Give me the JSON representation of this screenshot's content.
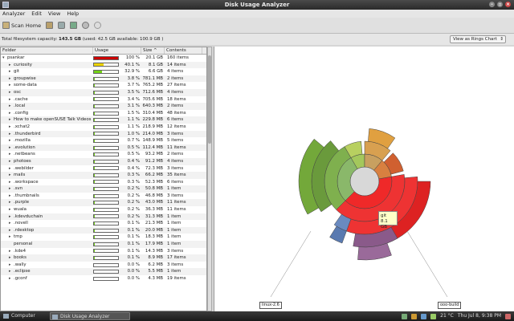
{
  "window": {
    "title": "Disk Usage Analyzer"
  },
  "menu": [
    "Analyzer",
    "Edit",
    "View",
    "Help"
  ],
  "toolbar": {
    "scan_home": "Scan Home"
  },
  "info": {
    "capacity_label": "Total filesystem capacity:",
    "capacity_value": "143.5 GB",
    "usage_detail": "(used: 42.5 GB available: 100.9 GB )"
  },
  "view_select": {
    "value": "View as Rings Chart"
  },
  "columns": {
    "folder": "Folder",
    "usage": "Usage",
    "size": "Size",
    "contents": "Contents"
  },
  "rows": [
    {
      "name": "psankar",
      "pct": "100 %",
      "size": "20.1 GB",
      "contents": "160 items",
      "fill": 1.0,
      "color": "#cc0000",
      "open": true,
      "indent": 0
    },
    {
      "name": "curiosity",
      "pct": "40.1 %",
      "size": "8.1 GB",
      "contents": "14 items",
      "fill": 0.401,
      "color": "#edd400",
      "indent": 1
    },
    {
      "name": "git",
      "pct": "32.9 %",
      "size": "6.6 GB",
      "contents": "4 items",
      "fill": 0.329,
      "color": "#73d216",
      "indent": 1
    },
    {
      "name": "groupwise",
      "pct": "3.8 %",
      "size": "781.1 MB",
      "contents": "2 items",
      "fill": 0.038,
      "color": "#73d216",
      "indent": 1
    },
    {
      "name": "some-data",
      "pct": "3.7 %",
      "size": "765.2 MB",
      "contents": "27 items",
      "fill": 0.037,
      "color": "#73d216",
      "indent": 1
    },
    {
      "name": "osc",
      "pct": "3.5 %",
      "size": "712.6 MB",
      "contents": "4 items",
      "fill": 0.035,
      "color": "#73d216",
      "indent": 1
    },
    {
      "name": ".cache",
      "pct": "3.4 %",
      "size": "705.6 MB",
      "contents": "18 items",
      "fill": 0.034,
      "color": "#73d216",
      "indent": 1
    },
    {
      "name": ".local",
      "pct": "3.1 %",
      "size": "640.3 MB",
      "contents": "2 items",
      "fill": 0.031,
      "color": "#73d216",
      "indent": 1
    },
    {
      "name": ".config",
      "pct": "1.5 %",
      "size": "310.4 MB",
      "contents": "48 items",
      "fill": 0.015,
      "color": "#73d216",
      "indent": 1
    },
    {
      "name": "How to make openSUSE Talk Videos",
      "pct": "1.1 %",
      "size": "229.8 MB",
      "contents": "6 items",
      "fill": 0.011,
      "color": "#73d216",
      "indent": 1
    },
    {
      "name": ".xchat2",
      "pct": "1.1 %",
      "size": "218.9 MB",
      "contents": "12 items",
      "fill": 0.011,
      "color": "#73d216",
      "indent": 1
    },
    {
      "name": ".thunderbird",
      "pct": "1.0 %",
      "size": "214.0 MB",
      "contents": "3 items",
      "fill": 0.01,
      "color": "#73d216",
      "indent": 1
    },
    {
      "name": ".mozilla",
      "pct": "0.7 %",
      "size": "148.9 MB",
      "contents": "5 items",
      "fill": 0.007,
      "color": "#73d216",
      "indent": 1
    },
    {
      "name": ".evolution",
      "pct": "0.5 %",
      "size": "112.4 MB",
      "contents": "11 items",
      "fill": 0.005,
      "color": "#73d216",
      "indent": 1
    },
    {
      "name": ".netbeans",
      "pct": "0.5 %",
      "size": "93.2 MB",
      "contents": "2 items",
      "fill": 0.005,
      "color": "#73d216",
      "indent": 1
    },
    {
      "name": "photoes",
      "pct": "0.4 %",
      "size": "91.2 MB",
      "contents": "4 items",
      "fill": 0.004,
      "color": "#73d216",
      "indent": 1
    },
    {
      "name": ".webilder",
      "pct": "0.4 %",
      "size": "72.3 MB",
      "contents": "3 items",
      "fill": 0.004,
      "color": "#73d216",
      "indent": 1
    },
    {
      "name": "mails",
      "pct": "0.3 %",
      "size": "66.2 MB",
      "contents": "35 items",
      "fill": 0.003,
      "color": "#73d216",
      "indent": 1
    },
    {
      "name": ".workspace",
      "pct": "0.3 %",
      "size": "52.3 MB",
      "contents": "6 items",
      "fill": 0.003,
      "color": "#73d216",
      "indent": 1
    },
    {
      "name": ".svn",
      "pct": "0.2 %",
      "size": "50.8 MB",
      "contents": "1 item",
      "fill": 0.002,
      "color": "#73d216",
      "indent": 1
    },
    {
      "name": ".thumbnails",
      "pct": "0.2 %",
      "size": "46.8 MB",
      "contents": "3 items",
      "fill": 0.002,
      "color": "#73d216",
      "indent": 1
    },
    {
      "name": ".purple",
      "pct": "0.2 %",
      "size": "43.0 MB",
      "contents": "11 items",
      "fill": 0.002,
      "color": "#73d216",
      "indent": 1
    },
    {
      "name": "wuala",
      "pct": "0.2 %",
      "size": "36.3 MB",
      "contents": "11 items",
      "fill": 0.002,
      "color": "#73d216",
      "indent": 1
    },
    {
      "name": ".kdevduchain",
      "pct": "0.2 %",
      "size": "31.3 MB",
      "contents": "1 item",
      "fill": 0.002,
      "color": "#73d216",
      "indent": 1
    },
    {
      "name": ".novell",
      "pct": "0.1 %",
      "size": "21.3 MB",
      "contents": "1 item",
      "fill": 0.001,
      "color": "#73d216",
      "indent": 1
    },
    {
      "name": ".rdesktop",
      "pct": "0.1 %",
      "size": "20.0 MB",
      "contents": "1 item",
      "fill": 0.001,
      "color": "#73d216",
      "indent": 1
    },
    {
      "name": "tmp",
      "pct": "0.1 %",
      "size": "18.3 MB",
      "contents": "1 item",
      "fill": 0.001,
      "color": "#73d216",
      "indent": 1
    },
    {
      "name": "personal",
      "pct": "0.1 %",
      "size": "17.9 MB",
      "contents": "1 item",
      "fill": 0.001,
      "color": "#73d216",
      "indent": 1,
      "leaf": true
    },
    {
      "name": ".kde4",
      "pct": "0.1 %",
      "size": "14.3 MB",
      "contents": "3 items",
      "fill": 0.001,
      "color": "#73d216",
      "indent": 1
    },
    {
      "name": "books",
      "pct": "0.1 %",
      "size": "8.9 MB",
      "contents": "17 items",
      "fill": 0.001,
      "color": "#73d216",
      "indent": 1
    },
    {
      "name": ".wally",
      "pct": "0.0 %",
      "size": "6.2 MB",
      "contents": "3 items",
      "fill": 0.0,
      "color": "#73d216",
      "indent": 1
    },
    {
      "name": ".eclipse",
      "pct": "0.0 %",
      "size": "5.5 MB",
      "contents": "1 item",
      "fill": 0.0,
      "color": "#73d216",
      "indent": 1
    },
    {
      "name": ".gconf",
      "pct": "0.0 %",
      "size": "4.3 MB",
      "contents": "19 items",
      "fill": 0.0,
      "color": "#73d216",
      "indent": 1
    }
  ],
  "chart": {
    "tooltip_name": "git",
    "tooltip_size": "8.1 GB",
    "label_left": "linux-2.6",
    "label_right": "ooo-build"
  },
  "taskbar": {
    "computer": "Computer",
    "app": "Disk Usage Analyzer",
    "temp": "21 °C",
    "clock": "Thu Jul  8,   9:38 PM"
  }
}
